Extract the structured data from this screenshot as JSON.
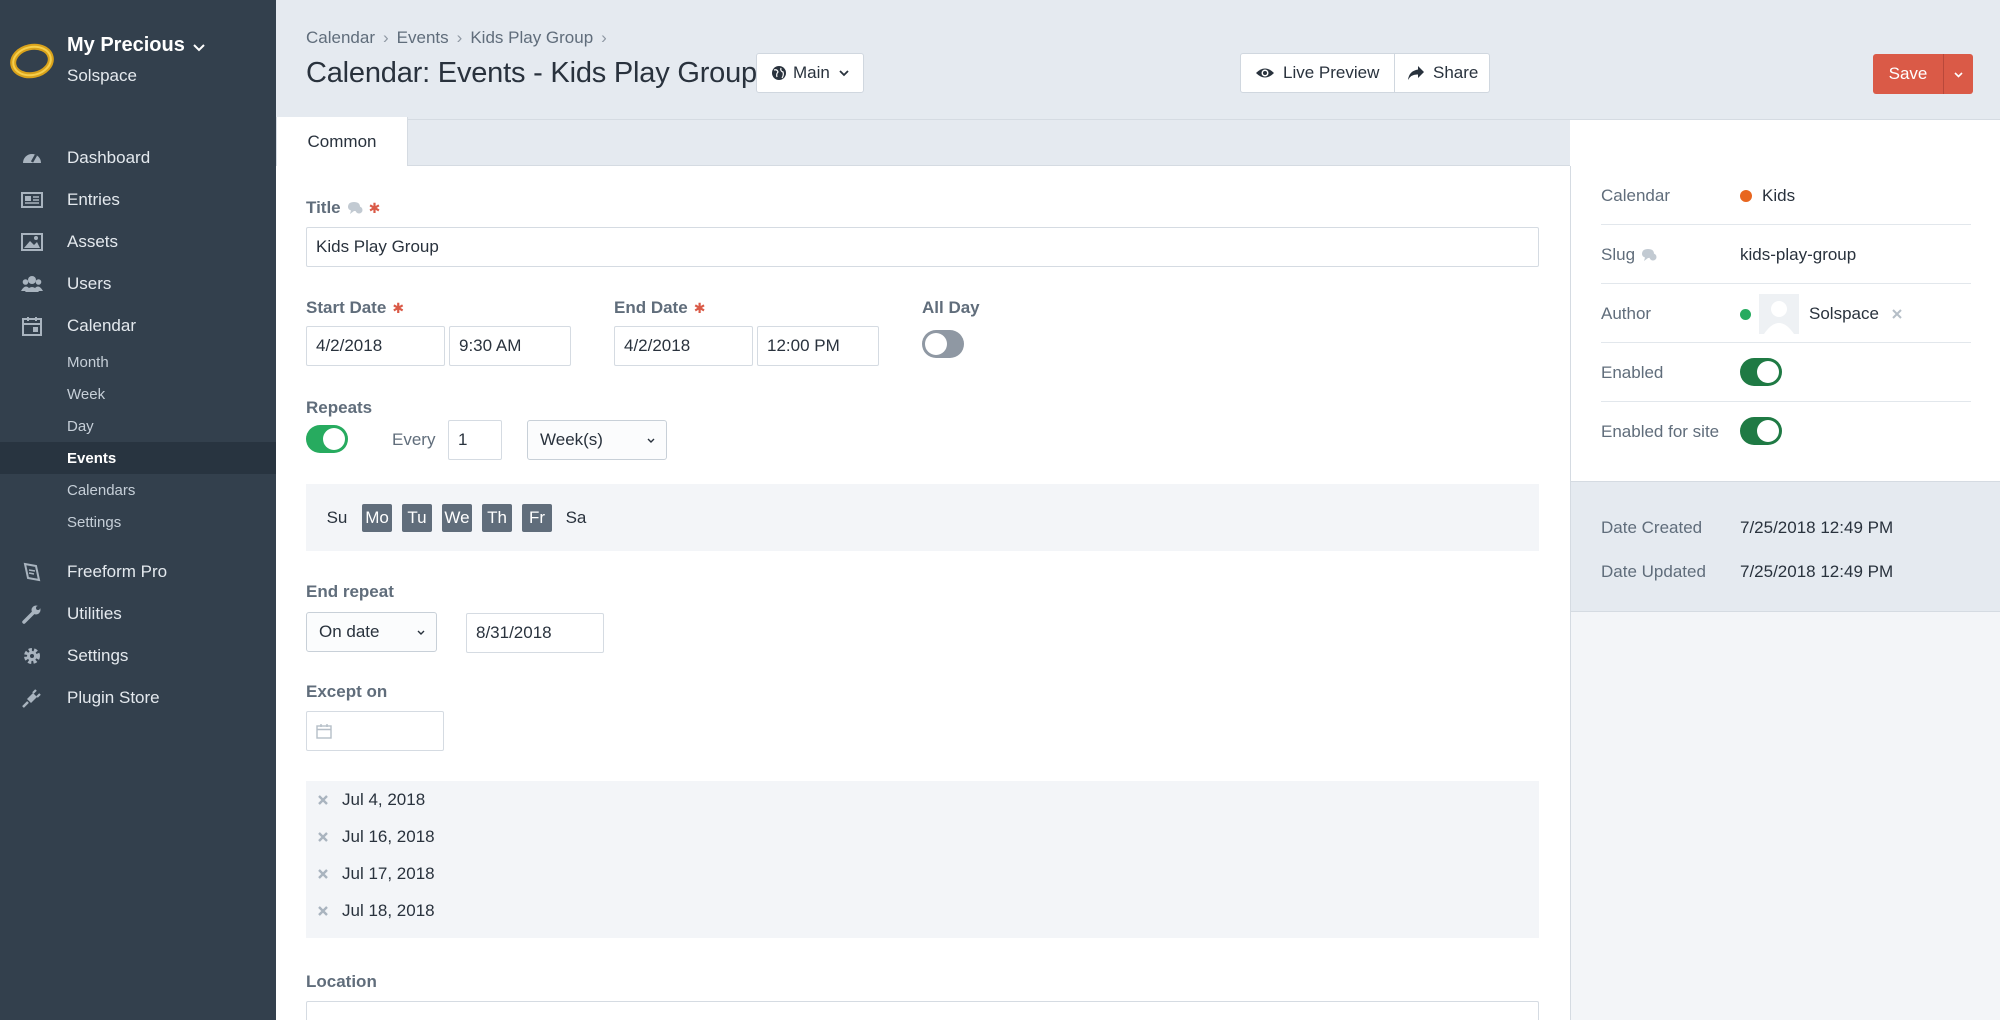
{
  "brand": {
    "name": "My Precious",
    "site": "Solspace"
  },
  "nav": {
    "dashboard": "Dashboard",
    "entries": "Entries",
    "assets": "Assets",
    "users": "Users",
    "calendar": "Calendar",
    "calendar_sub": [
      "Month",
      "Week",
      "Day",
      "Events",
      "Calendars",
      "Settings"
    ],
    "active_sub": "Events",
    "freeform": "Freeform Pro",
    "utilities": "Utilities",
    "settings": "Settings",
    "plugin_store": "Plugin Store"
  },
  "header": {
    "breadcrumb": [
      "Calendar",
      "Events",
      "Kids Play Group"
    ],
    "title": "Calendar: Events - Kids Play Group",
    "site_selector": "Main",
    "live_preview": "Live Preview",
    "share": "Share",
    "save": "Save"
  },
  "tabs": [
    {
      "label": "Common",
      "active": true
    }
  ],
  "form": {
    "title_label": "Title",
    "title_value": "Kids Play Group",
    "start_label": "Start Date",
    "start_date": "4/2/2018",
    "start_time": "9:30 AM",
    "end_label": "End Date",
    "end_date": "4/2/2018",
    "end_time": "12:00 PM",
    "all_day_label": "All Day",
    "all_day": false,
    "repeats_label": "Repeats",
    "repeats": true,
    "every_label": "Every",
    "every_value": "1",
    "interval": "Week(s)",
    "days": [
      {
        "label": "Su",
        "selected": false
      },
      {
        "label": "Mo",
        "selected": true
      },
      {
        "label": "Tu",
        "selected": true
      },
      {
        "label": "We",
        "selected": true
      },
      {
        "label": "Th",
        "selected": true
      },
      {
        "label": "Fr",
        "selected": true
      },
      {
        "label": "Sa",
        "selected": false
      }
    ],
    "end_repeat_label": "End repeat",
    "end_repeat_mode": "On date",
    "end_repeat_date": "8/31/2018",
    "except_label": "Except on",
    "except_dates": [
      "Jul 4, 2018",
      "Jul 16, 2018",
      "Jul 17, 2018",
      "Jul 18, 2018"
    ],
    "location_label": "Location"
  },
  "details": {
    "calendar_label": "Calendar",
    "calendar_value": "Kids",
    "calendar_color": "#e8661f",
    "slug_label": "Slug",
    "slug_value": "kids-play-group",
    "author_label": "Author",
    "author_value": "Solspace",
    "author_status_color": "#27ab5f",
    "enabled_label": "Enabled",
    "enabled": true,
    "enabled_site_label": "Enabled for site",
    "enabled_site": true,
    "date_created_label": "Date Created",
    "date_created": "7/25/2018 12:49 PM",
    "date_updated_label": "Date Updated",
    "date_updated": "7/25/2018 12:49 PM"
  },
  "colors": {
    "sidebar": "#33404d",
    "accent_save": "#da5a47",
    "toggle_on": "#27ab5f",
    "required": "#da5a47"
  }
}
